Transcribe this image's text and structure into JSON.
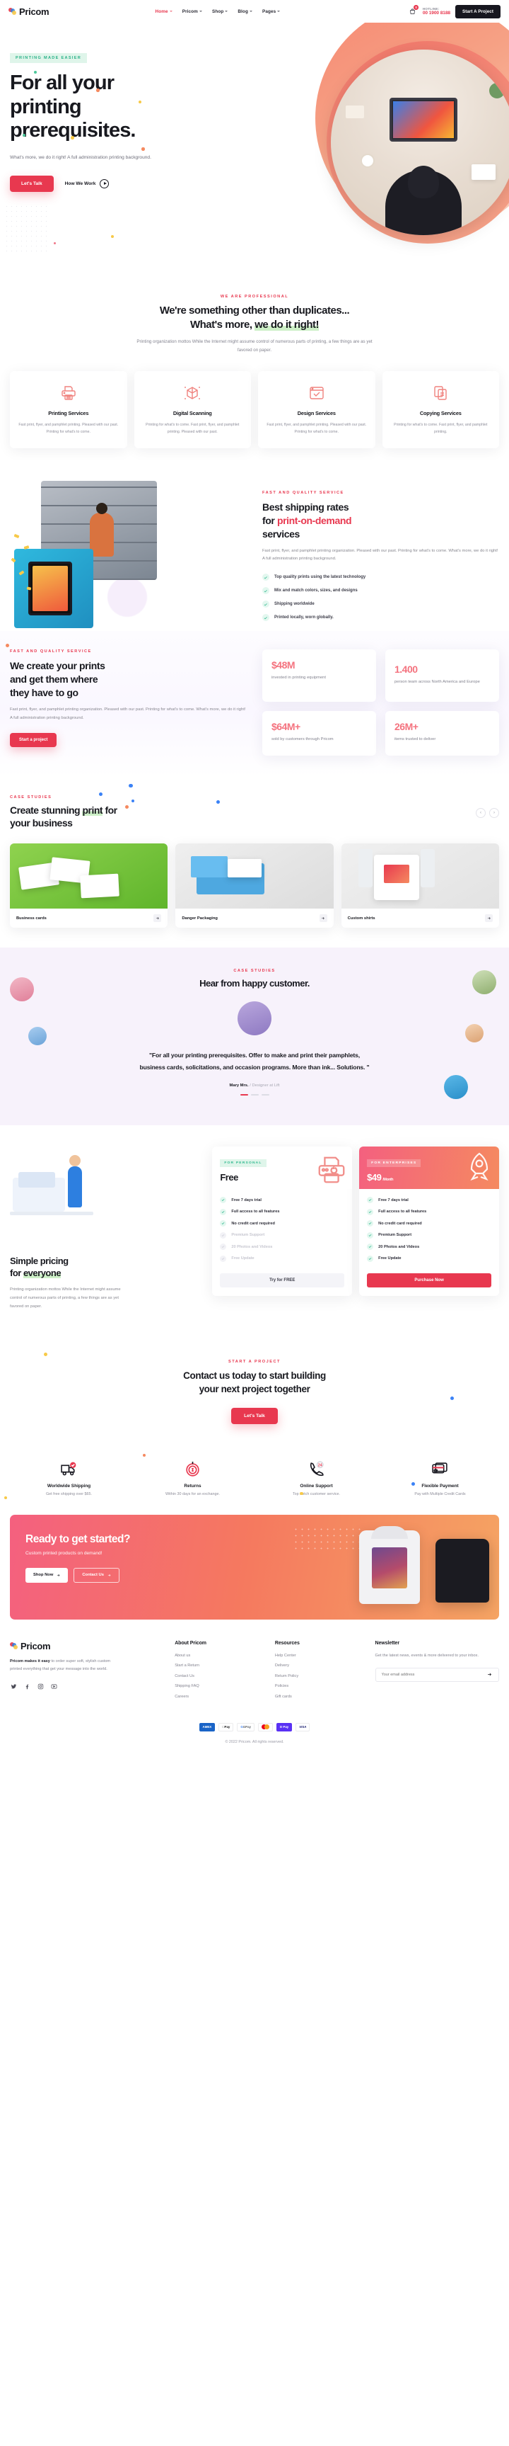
{
  "brand": {
    "name": "Pricom"
  },
  "header": {
    "nav": [
      {
        "label": "Home",
        "active": true
      },
      {
        "label": "Pricom",
        "active": false
      },
      {
        "label": "Shop",
        "active": false
      },
      {
        "label": "Blog",
        "active": false
      },
      {
        "label": "Pages",
        "active": false
      }
    ],
    "cart_count": "0",
    "hotline_label": "HOTLINE:",
    "hotline_number": "00 1900 8188",
    "cta": "Start A Project"
  },
  "hero": {
    "badge": "PRINTING MADE EASIER",
    "title_line1": "For all your",
    "title_line2": "printing",
    "title_line3": "prerequisites.",
    "paragraph": "What's more, we do it right! A full administration printing background.",
    "primary_cta": "Let's Talk",
    "secondary_cta": "How We Work"
  },
  "professional": {
    "eyebrow": "WE ARE PROFESSIONAL",
    "title_line1": "We're something other than duplicates...",
    "title_line2_plain": "What's more, ",
    "title_line2_highlight": "we do it right!",
    "lead": "Printing organization mottos While the Internet might assume control of numerous parts of printing, a few things are as yet favored on paper.",
    "services": [
      {
        "icon": "printer-icon",
        "title": "Printing Services",
        "desc": "Fast print, flyer, and pamphlet printing. Pleased with our past. Printing for what's to come."
      },
      {
        "icon": "scan-cube-icon",
        "title": "Digital Scanning",
        "desc": "Printing for what's to come. Fast print, flyer, and pamphlet printing. Pleased with our past."
      },
      {
        "icon": "design-window-icon",
        "title": "Design Services",
        "desc": "Fast print, flyer, and pamphlet printing. Pleased with our past. Printing for what's to come."
      },
      {
        "icon": "copy-documents-icon",
        "title": "Copying Services",
        "desc": "Printing for what's to come. Fast print, flyer, and pamphlet printing."
      }
    ]
  },
  "shipping": {
    "eyebrow": "FAST AND QUALITY SERVICE",
    "title_line1": "Best shipping rates",
    "title_line2_plain": "for ",
    "title_line2_accent": "print-on-demand",
    "title_line3": "services",
    "paragraph": "Fast print, flyer, and pamphlet printing organization. Pleased with our past. Printing for what's to come. What's more, we do it right! A full administration printing background.",
    "checks": [
      "Top quality prints using the latest technology",
      "Mix and match colors, sizes, and designs",
      "Shipping worldwide",
      "Printed locally, worn globally."
    ]
  },
  "prints": {
    "eyebrow": "FAST AND QUALITY SERVICE",
    "title_line1": "We create your prints",
    "title_line2": "and get them where",
    "title_line3": "they have to go",
    "paragraph": "Fast print, flyer, and pamphlet printing organization. Pleased with our past. Printing for what's to come. What's more, we do it right! A full administration printing background.",
    "cta": "Start a project",
    "stats": [
      {
        "value": "$48M",
        "caption": "invested in printing equipment"
      },
      {
        "value": "1.400",
        "caption": "person team across North America and Europe"
      },
      {
        "value": "$64M+",
        "caption": "sold by customers through Pricom"
      },
      {
        "value": "26M+",
        "caption": "items trusted to deliver"
      }
    ]
  },
  "case_studies": {
    "eyebrow": "CASE STUDIES",
    "title_line1": "Create stunning ",
    "title_highlight": "print",
    "title_line1_end": " for",
    "title_line2": "your business",
    "prev": "‹",
    "next": "›",
    "cards": [
      {
        "label": "Business cards"
      },
      {
        "label": "Danger Packaging"
      },
      {
        "label": "Custom shirts"
      }
    ]
  },
  "testimonial": {
    "eyebrow": "CASE STUDIES",
    "title": "Hear from happy customer.",
    "quote": "\"For all your printing prerequisites. Offer to make and print their pamphlets, business cards, solicitations, and occasion programs. More than ink... Solutions. \"",
    "author_name": "Mary Mrs.",
    "author_role": "/ Designer at Lift"
  },
  "pricing": {
    "title_line1": "Simple pricing",
    "title_line2_plain": "for ",
    "title_line2_highlight": "everyone",
    "paragraph": "Printing organization mottos While the Internet might assume control of numerous parts of printing, a few things are as yet favored on paper.",
    "plans": [
      {
        "tag": "FOR PERSONAL",
        "price": "Free",
        "per": "",
        "features": [
          {
            "label": "Free 7 days trial",
            "on": true
          },
          {
            "label": "Full access to all features",
            "on": true
          },
          {
            "label": "No credit card required",
            "on": true
          },
          {
            "label": "Premium Support",
            "on": false
          },
          {
            "label": "20 Photos and Videos",
            "on": false
          },
          {
            "label": "Free Update",
            "on": false
          }
        ],
        "cta": "Try for FREE"
      },
      {
        "tag": "FOR ENTERPRISES",
        "price": "$49",
        "per": "/Month",
        "features": [
          {
            "label": "Free 7 days trial",
            "on": true
          },
          {
            "label": "Full access to all features",
            "on": true
          },
          {
            "label": "No credit card required",
            "on": true
          },
          {
            "label": "Premium Support",
            "on": true
          },
          {
            "label": "20 Photos and Videos",
            "on": true
          },
          {
            "label": "Free Update",
            "on": true
          }
        ],
        "cta": "Purchase Now"
      }
    ]
  },
  "contact_cta": {
    "eyebrow": "START A PROJECT",
    "title_line1": "Contact us today to start building",
    "title_line2": "your next project together",
    "cta": "Let's Talk"
  },
  "benefits": [
    {
      "icon": "delivery-truck-icon",
      "title": "Worldwide Shipping",
      "desc": "Get free shipping over $65."
    },
    {
      "icon": "money-back-icon",
      "title": "Returns",
      "desc": "Within 30 days for an exchange."
    },
    {
      "icon": "phone-24-icon",
      "title": "Online Support",
      "desc": "Top notch customer service."
    },
    {
      "icon": "credit-card-icon",
      "title": "Flexible Payment",
      "desc": "Pay with Multiple Credit Cards"
    }
  ],
  "ready": {
    "title": "Ready to get started?",
    "subtitle": "Custom printed products on demand!",
    "shop_cta": "Shop Now",
    "contact_cta": "Contact Us"
  },
  "footer": {
    "about_text_bold": "Pricom makes it easy",
    "about_text": " to order super soft, stylish custom printed everything that get your message into the world.",
    "social": [
      "twitter-icon",
      "facebook-icon",
      "instagram-icon",
      "youtube-icon"
    ],
    "columns": [
      {
        "heading": "About Pricom",
        "links": [
          "About us",
          "Start a Return",
          "Contact Us",
          "Shipping FAQ",
          "Careers"
        ]
      },
      {
        "heading": "Resources",
        "links": [
          "Help Center",
          "Delivery",
          "Return Policy",
          "Policies",
          "Gift cards"
        ]
      }
    ],
    "newsletter": {
      "heading": "Newsletter",
      "text": "Get the latest news, events & more delivered to your inbox.",
      "placeholder": "Your email address",
      "submit_icon": "arrow-right-icon"
    },
    "payments": [
      "AMEX",
      "Pay",
      "GPay",
      "mastercard",
      "D Pay",
      "VISA"
    ],
    "copyright": "© 2022 Pricom. All rights reserved."
  },
  "colors": {
    "accent_red": "#e8384f",
    "mint": "#2fb98f",
    "coral": "#f4737f",
    "dark": "#17171f"
  }
}
